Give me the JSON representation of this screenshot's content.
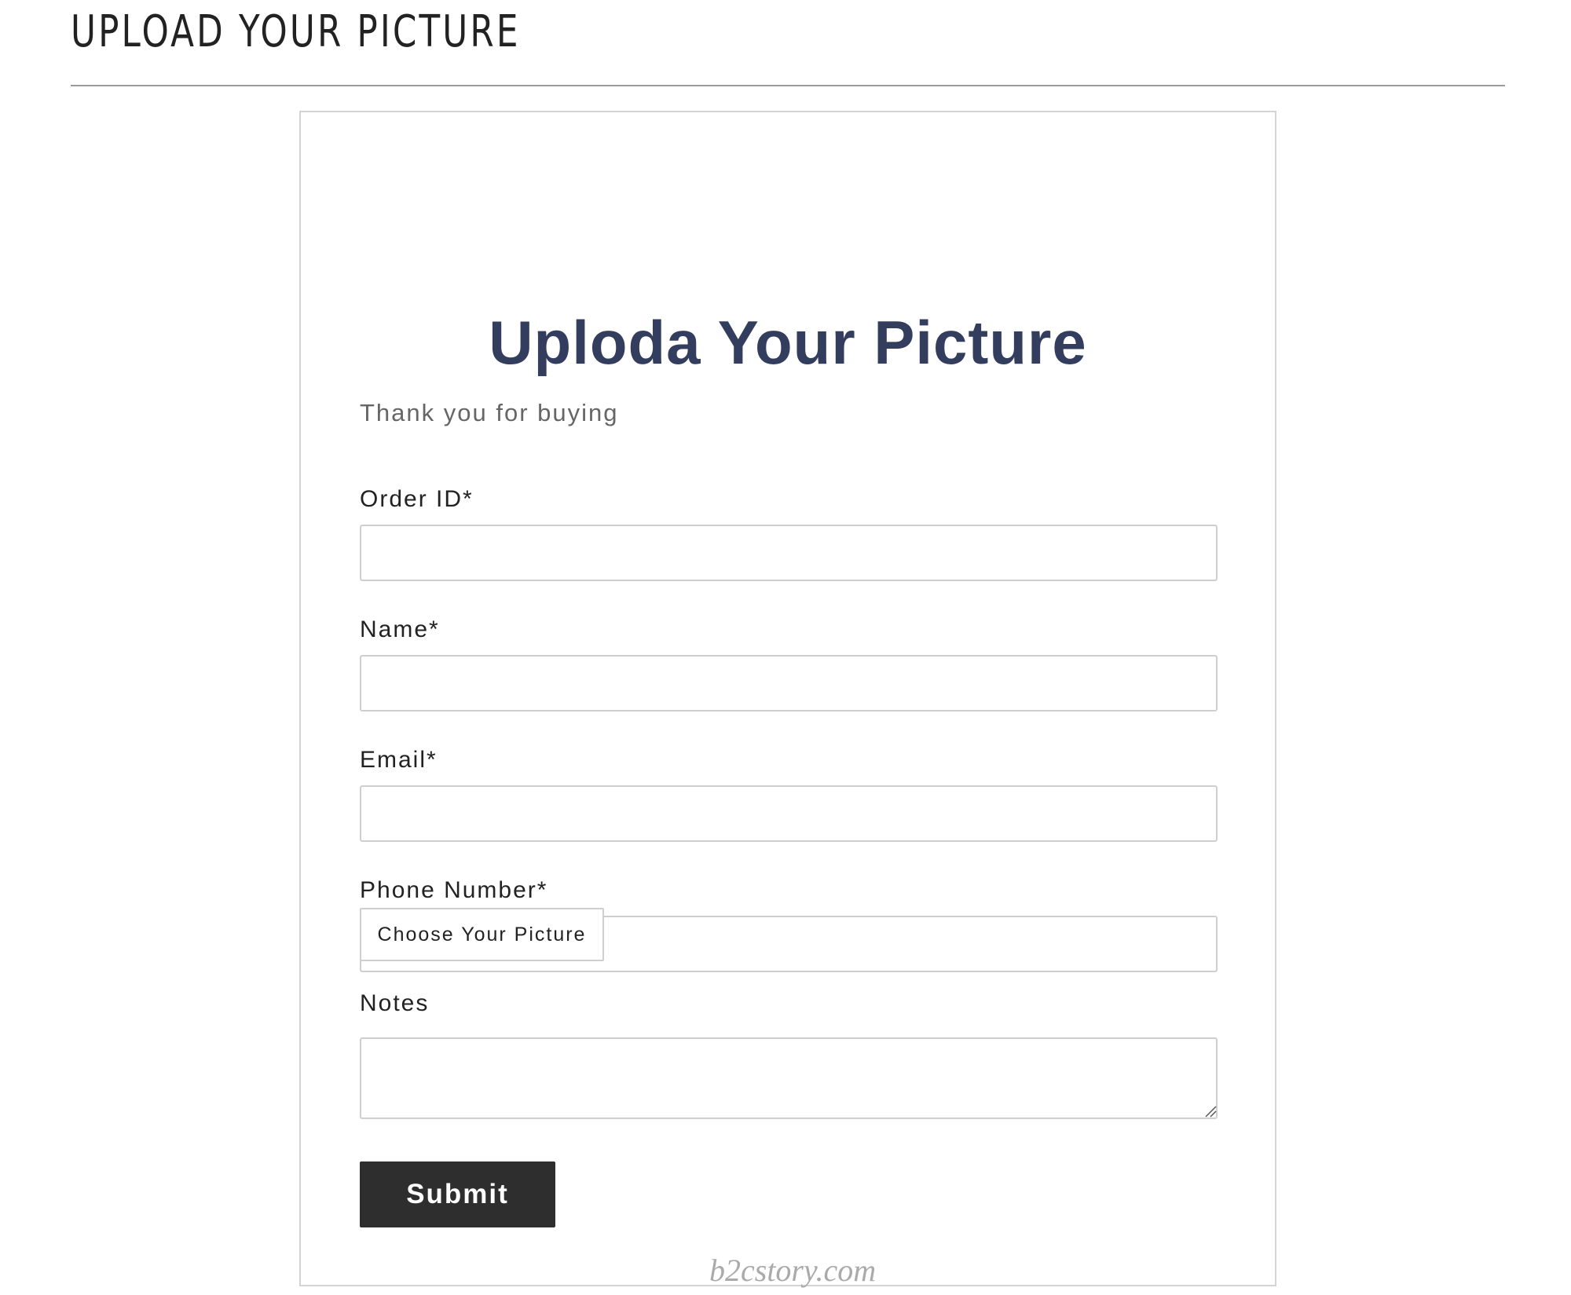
{
  "page": {
    "title": "UPLOAD YOUR PICTURE"
  },
  "form": {
    "heading": "Uploda Your Picture",
    "subtitle": "Thank you for buying",
    "fields": {
      "order_id": {
        "label": "Order ID*",
        "value": ""
      },
      "name": {
        "label": "Name*",
        "value": ""
      },
      "email": {
        "label": "Email*",
        "value": ""
      },
      "phone": {
        "label": "Phone Number*",
        "value": ""
      },
      "notes": {
        "label": "Notes",
        "value": ""
      }
    },
    "file_button_label": "Choose Your Picture",
    "submit_label": "Submit"
  },
  "watermark": "b2cstory.com",
  "colors": {
    "heading": "#333d5e",
    "submit_bg": "#2e2e2e",
    "border": "#cfcfcf"
  }
}
